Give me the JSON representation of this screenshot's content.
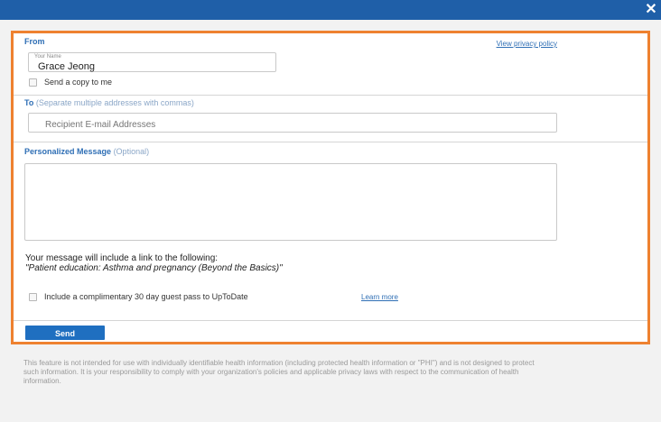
{
  "window": {
    "close_glyph": "✕"
  },
  "from": {
    "label": "From",
    "privacy_link": "View privacy policy",
    "name_field": {
      "caption": "Your Name",
      "value": "Grace Jeong"
    },
    "send_copy_label": "Send a copy to me"
  },
  "to": {
    "label": "To",
    "hint": "(Separate multiple addresses with commas)",
    "recipient_placeholder": "Recipient E-mail Addresses"
  },
  "message": {
    "label": "Personalized Message",
    "hint": "(Optional)",
    "value": "",
    "include_line": "Your message will include a link to the following:",
    "topic_line": "\"Patient education: Asthma and pregnancy (Beyond the Basics)\"",
    "guest_pass_label": "Include a complimentary 30 day guest pass to UpToDate",
    "learn_more": "Learn more"
  },
  "actions": {
    "send_label": "Send"
  },
  "disclaimer": "This feature is not intended for use with individually identifiable health information (including protected health information or \"PHI\") and is not designed to protect such information. It is your responsibility to comply with your organization's policies and applicable privacy laws with respect to the communication of health information.",
  "colors": {
    "accent_border": "#ee8130",
    "link_blue": "#2f6fb5",
    "button_blue": "#1f6fc0"
  }
}
